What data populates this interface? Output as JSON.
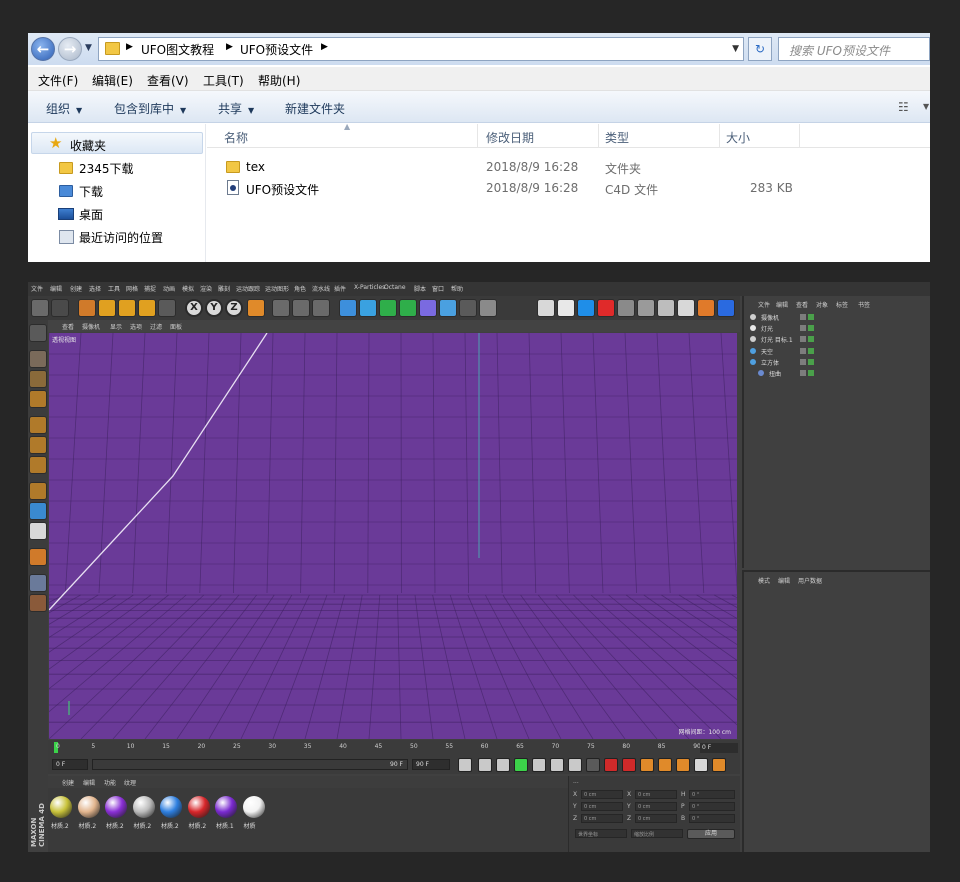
{
  "explorer": {
    "breadcrumb": [
      "UFO图文教程",
      "UFO预设文件"
    ],
    "search_placeholder": "搜索 UFO预设文件",
    "menu": [
      "文件(F)",
      "编辑(E)",
      "查看(V)",
      "工具(T)",
      "帮助(H)"
    ],
    "commands": [
      "组织",
      "包含到库中",
      "共享",
      "新建文件夹"
    ],
    "favorites_label": "收藏夹",
    "nav_items": [
      "2345下载",
      "下载",
      "桌面",
      "最近访问的位置"
    ],
    "columns": [
      "名称",
      "修改日期",
      "类型",
      "大小"
    ],
    "files": [
      {
        "name": "tex",
        "date": "2018/8/9 16:28",
        "type": "文件夹",
        "size": ""
      },
      {
        "name": "UFO预设文件",
        "date": "2018/8/9 16:28",
        "type": "C4D 文件",
        "size": "283 KB"
      }
    ]
  },
  "c4d": {
    "menu": [
      "文件",
      "编辑",
      "创建",
      "选择",
      "工具",
      "网格",
      "捕捉",
      "动画",
      "模拟",
      "渲染",
      "雕刻",
      "运动跟踪",
      "运动图形",
      "角色",
      "流水线",
      "插件",
      "X-Particles",
      "Octane",
      "脚本",
      "窗口",
      "帮助"
    ],
    "viewport_menu": [
      "查看",
      "摄像机",
      "显示",
      "选项",
      "过滤",
      "面板"
    ],
    "viewport_label": "透视视图",
    "grid_label": "网格间距：100 cm",
    "timeline_ticks": [
      "0",
      "5",
      "10",
      "15",
      "20",
      "25",
      "30",
      "35",
      "40",
      "45",
      "50",
      "55",
      "60",
      "65",
      "70",
      "75",
      "80",
      "85",
      "90"
    ],
    "frame_end_field": "0 F",
    "transport": {
      "start": "0 F",
      "range_end": "90 F",
      "end": "90 F"
    },
    "material_menu": [
      "创建",
      "编辑",
      "功能",
      "纹理"
    ],
    "materials": [
      {
        "label": "材质.2",
        "color": "#c8c23a"
      },
      {
        "label": "材质.2",
        "color": "#e2b58e"
      },
      {
        "label": "材质.2",
        "color": "#8a2fd6"
      },
      {
        "label": "材质.2",
        "color": "#bcbcbc"
      },
      {
        "label": "材质.2",
        "color": "#2e7fe0"
      },
      {
        "label": "材质.2",
        "color": "#d8262a"
      },
      {
        "label": "材质.1",
        "color": "#7a2ad0"
      },
      {
        "label": "材质",
        "color": "#f2f2f2"
      }
    ],
    "maxon_logo": "MAXON CINEMA 4D",
    "coords": {
      "rows": [
        "X",
        "Y",
        "Z"
      ],
      "mid": [
        "X",
        "Y",
        "Z"
      ],
      "right": [
        "H",
        "P",
        "B"
      ],
      "pos": "0 cm",
      "size": "0 cm",
      "rot": "0 °",
      "world": "世界坐标",
      "scale": "缩放比例",
      "apply": "应用"
    },
    "object_menu": [
      "文件",
      "编辑",
      "查看",
      "对象",
      "标签",
      "书签"
    ],
    "objects": [
      "摄像机",
      "灯光",
      "灯光 目标.1",
      "天空",
      "立方体",
      "扭曲"
    ],
    "attr_menu": [
      "模式",
      "编辑",
      "用户数据"
    ],
    "colors": {
      "viewport": "#6a3a98",
      "grid_line": "#3a1f5c",
      "spline": "#e7dff2"
    }
  }
}
